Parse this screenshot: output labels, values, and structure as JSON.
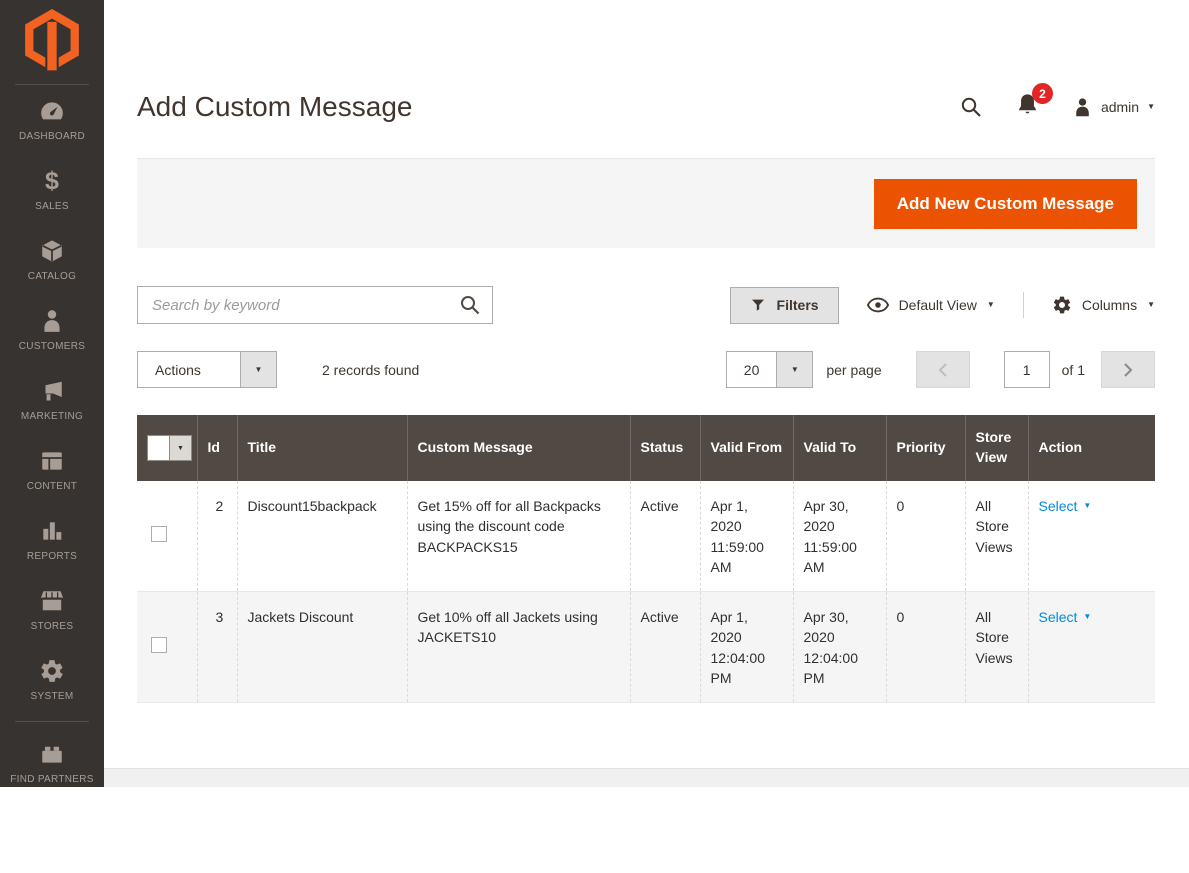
{
  "colors": {
    "accent_orange": "#eb5202",
    "link_blue": "#008bdb",
    "badge_red": "#e22626",
    "sidebar_bg": "#373330",
    "table_header_bg": "#514943"
  },
  "icons": {
    "caret_down": "▼",
    "sales_glyph": "$"
  },
  "sidebar": {
    "items": [
      {
        "label": "DASHBOARD",
        "icon": "dashboard-icon"
      },
      {
        "label": "SALES",
        "icon": "sales-icon"
      },
      {
        "label": "CATALOG",
        "icon": "catalog-icon"
      },
      {
        "label": "CUSTOMERS",
        "icon": "customers-icon"
      },
      {
        "label": "MARKETING",
        "icon": "marketing-icon"
      },
      {
        "label": "CONTENT",
        "icon": "content-icon"
      },
      {
        "label": "REPORTS",
        "icon": "reports-icon"
      },
      {
        "label": "STORES",
        "icon": "stores-icon"
      },
      {
        "label": "SYSTEM",
        "icon": "system-icon"
      },
      {
        "label": "FIND PARTNERS",
        "icon": "find-partners-icon"
      }
    ]
  },
  "header": {
    "title": "Add Custom Message",
    "user": "admin",
    "notification_count": "2"
  },
  "toolbar": {
    "add_button": "Add New Custom Message"
  },
  "grid_controls": {
    "search_placeholder": "Search by keyword",
    "filters_label": "Filters",
    "view_label": "Default View",
    "columns_label": "Columns",
    "actions_label": "Actions",
    "records_found": "2 records found",
    "per_page_value": "20",
    "per_page_label": "per page",
    "page_value": "1",
    "page_total_label": "of 1"
  },
  "table": {
    "columns": [
      "Id",
      "Title",
      "Custom Message",
      "Status",
      "Valid From",
      "Valid To",
      "Priority",
      "Store View",
      "Action"
    ],
    "rows": [
      {
        "id": "2",
        "title": "Discount15backpack",
        "message": "Get 15% off for all Backpacks using the discount code BACKPACKS15",
        "status": "Active",
        "valid_from": "Apr 1, 2020 11:59:00 AM",
        "valid_to": "Apr 30, 2020 11:59:00 AM",
        "priority": "0",
        "store_view": "All Store Views",
        "action": "Select"
      },
      {
        "id": "3",
        "title": "Jackets Discount",
        "message": "Get 10% off all Jackets using JACKETS10",
        "status": "Active",
        "valid_from": "Apr 1, 2020 12:04:00 PM",
        "valid_to": "Apr 30, 2020 12:04:00 PM",
        "priority": "0",
        "store_view": "All Store Views",
        "action": "Select"
      }
    ]
  }
}
